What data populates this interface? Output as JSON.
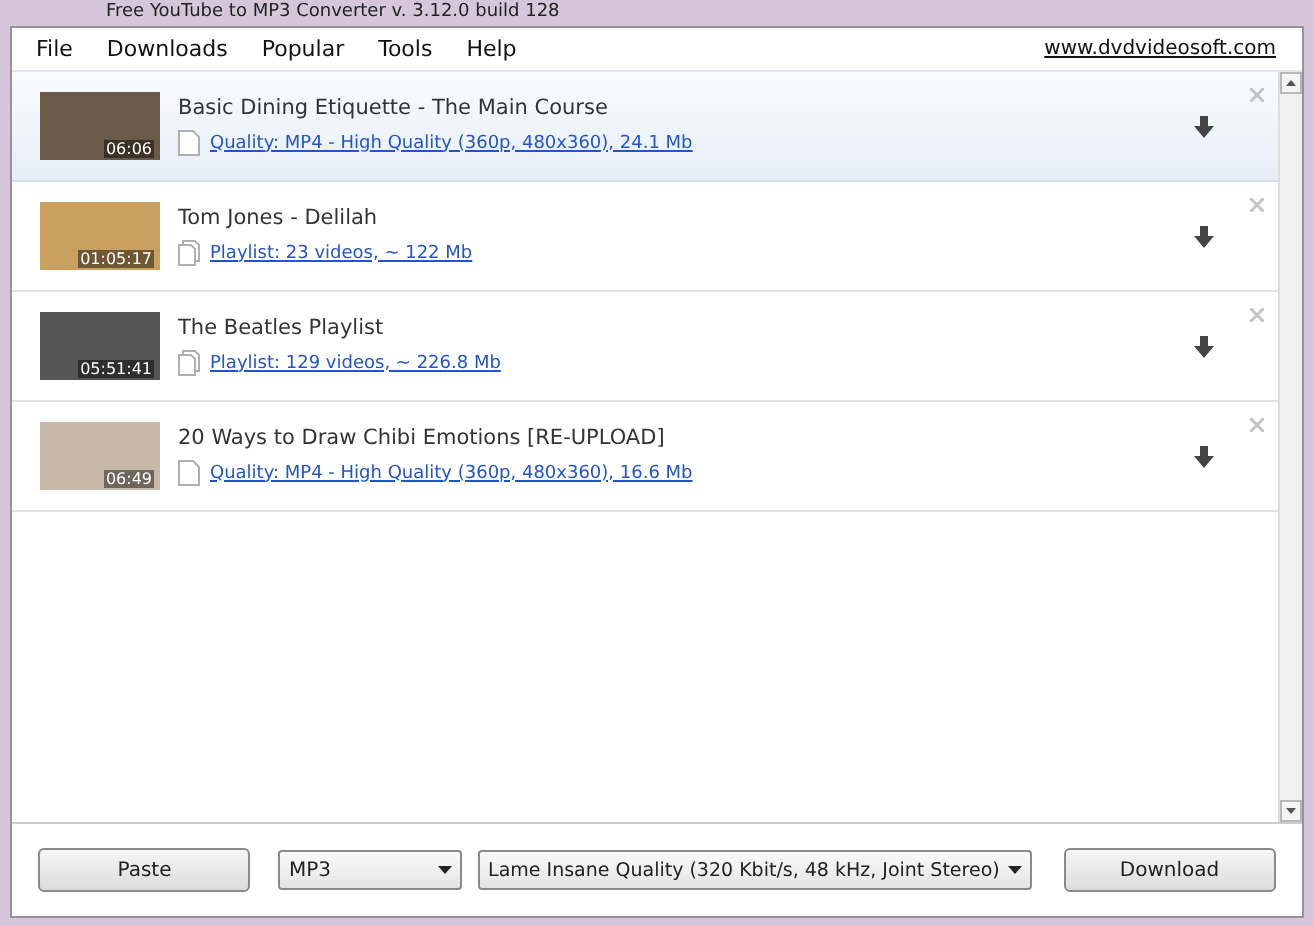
{
  "window": {
    "title": "Free YouTube to MP3 Converter  v. 3.12.0 build 128"
  },
  "menu": [
    "File",
    "Downloads",
    "Popular",
    "Tools",
    "Help"
  ],
  "site_link": "www.dvdvideosoft.com",
  "videos": [
    {
      "title": "Basic Dining Etiquette - The Main Course",
      "duration": "06:06",
      "info": "Quality: MP4 - High Quality (360p, 480x360), 24.1 Mb",
      "kind": "single",
      "selected": true
    },
    {
      "title": "Tom Jones - Delilah",
      "duration": "01:05:17",
      "info": "Playlist: 23 videos, ~ 122 Mb",
      "kind": "playlist",
      "selected": false
    },
    {
      "title": "The Beatles Playlist",
      "duration": "05:51:41",
      "info": "Playlist: 129 videos, ~ 226.8 Mb",
      "kind": "playlist",
      "selected": false
    },
    {
      "title": "20 Ways to Draw Chibi Emotions [RE-UPLOAD]",
      "duration": "06:49",
      "info": "Quality: MP4 - High Quality (360p, 480x360), 16.6 Mb",
      "kind": "single",
      "selected": false
    }
  ],
  "controls": {
    "paste": "Paste",
    "format": "MP3",
    "quality": "Lame Insane Quality (320 Kbit/s, 48 kHz, Joint Stereo)",
    "download": "Download"
  }
}
